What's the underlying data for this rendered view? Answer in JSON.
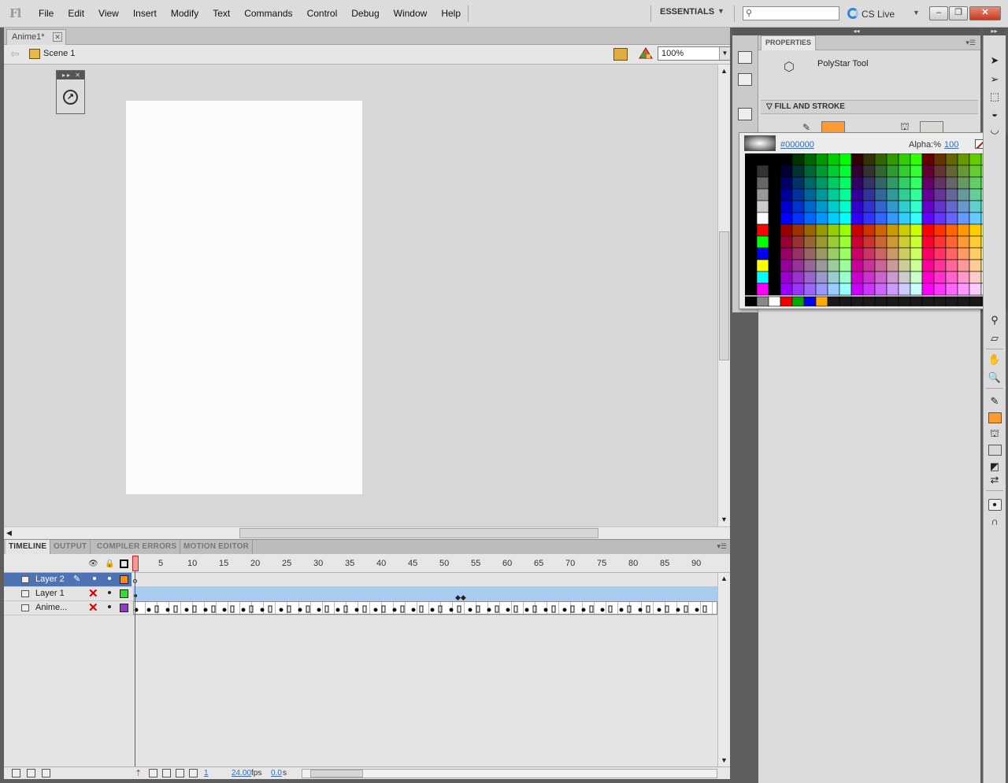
{
  "app": {
    "logo": "Fl",
    "menu": [
      "File",
      "Edit",
      "View",
      "Insert",
      "Modify",
      "Text",
      "Commands",
      "Control",
      "Debug",
      "Window",
      "Help"
    ],
    "workspace": "ESSENTIALS",
    "search_placeholder": "",
    "cs_live": "CS Live"
  },
  "document": {
    "tab_label": "Anime1*",
    "scene": "Scene 1",
    "zoom": "100%",
    "stage_color": "#fbfcfb"
  },
  "timeline": {
    "tabs": [
      "TIMELINE",
      "OUTPUT",
      "COMPILER ERRORS",
      "MOTION EDITOR"
    ],
    "ruler": [
      "5",
      "10",
      "15",
      "20",
      "25",
      "30",
      "35",
      "40",
      "45",
      "50",
      "55",
      "60",
      "65",
      "70",
      "75",
      "80",
      "85",
      "90"
    ],
    "current_frame": "1",
    "fps": "24.00",
    "fps_unit": "fps",
    "elapsed": "0.0",
    "elapsed_unit": "s",
    "layers": [
      {
        "name": "Layer 2",
        "color": "#ff8c1a",
        "selected": true
      },
      {
        "name": "Layer 1",
        "color": "#33dd33",
        "selected": false
      },
      {
        "name": "Anime...",
        "color": "#8e3ac2",
        "selected": false
      }
    ]
  },
  "properties": {
    "tab": "PROPERTIES",
    "tool_name": "PolyStar Tool",
    "fill_stroke_header": "FILL AND STROKE",
    "stroke_color": "#ff9933",
    "fill_color": "#dad8d3"
  },
  "swatches": {
    "hex": "#000000",
    "alpha_label": "Alpha:%",
    "alpha_value": "100"
  }
}
